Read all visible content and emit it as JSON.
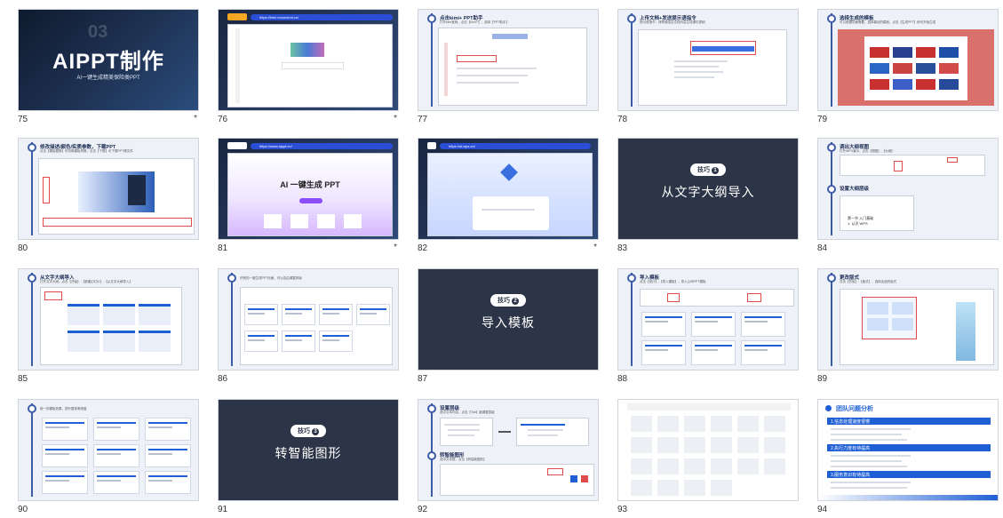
{
  "slides": [
    {
      "num": "75",
      "star": "*",
      "big_title": "AIPPT制作",
      "bg_number": "03",
      "subtitle": "AI一键生成精美保险类PPT"
    },
    {
      "num": "76",
      "star": "*",
      "url": "https://kimi.moonshot.cn/"
    },
    {
      "num": "77",
      "star": "",
      "title": "点击kimi+ PPT助手",
      "sub": "打开kimi官网，点击【Kimi+】，选择【PPT助手】"
    },
    {
      "num": "78",
      "star": "",
      "title": "上传文档+发送提示语指令",
      "sub": "提示语指令：请帮我结合文档内容生成课件提纲"
    },
    {
      "num": "79",
      "star": "",
      "title": "选择生成的模板",
      "sub": "可以根据场景需要，选择喜欢的模板，点击【生成PPT】即可开始生成"
    },
    {
      "num": "80",
      "star": "",
      "title": "修改描述/颜色/实质参数，下载PPT",
      "sub": "点击【模板替换】可切换模板风格，点击【下载】可下载PPT源文件"
    },
    {
      "num": "81",
      "star": "*",
      "url": "https://www.aippt.cn/",
      "hero": "AI 一键生成 PPT"
    },
    {
      "num": "82",
      "star": "*",
      "url": "https://ai.wps.cn/"
    },
    {
      "num": "83",
      "star": "",
      "pill": "技巧",
      "pill_n": "1",
      "main": "从文字大纲导入"
    },
    {
      "num": "84",
      "star": "",
      "title": "调出大纲视图",
      "sub": "打开WPS演示，点击【视图】-【大纲】",
      "title2": "设置大纲层级",
      "line1": "第一节 入门基础",
      "line2": "1. 认识 WPS"
    },
    {
      "num": "85",
      "star": "",
      "title": "从文字大纲导入",
      "sub": "打开文字大纲，点击【开始】-【新建幻灯片】-【从文字大纲导入】"
    },
    {
      "num": "86",
      "star": "",
      "sub": "识别的一键生成PPT页面，可以自由调整排版"
    },
    {
      "num": "87",
      "star": "",
      "pill": "技巧",
      "pill_n": "2",
      "main": "导入模板"
    },
    {
      "num": "88",
      "star": "",
      "title": "导入模板",
      "sub": "点击【设计】-【导入模板】，导入公司PPT模板"
    },
    {
      "num": "89",
      "star": "",
      "title": "更改版式",
      "sub": "点击【开始】-【版式】，选择合适的版式"
    },
    {
      "num": "90",
      "star": "",
      "sub": "统一的模板效果，提升整体美观度"
    },
    {
      "num": "91",
      "star": "",
      "pill": "技巧",
      "pill_n": "3",
      "main": "转智能图形"
    },
    {
      "num": "92",
      "star": "",
      "title": "设置层级",
      "sub": "选中文本内容，点击【Tab】键调整层级",
      "title2": "转智能图形",
      "sub2": "选中文本框，点击【转智能图形】"
    },
    {
      "num": "93",
      "star": "",
      "sub": ""
    },
    {
      "num": "94",
      "star": "",
      "heading": "团队问题分析",
      "sec1": "1.信息处理速度很慢",
      "sec2": "2.执行力度有待提高",
      "sec3": "3.服务意识有待提高"
    }
  ],
  "colors": {
    "accent": "#1f5fd6",
    "dark_slide": "#2c3447",
    "timeline": "#3d5ca8",
    "cover_bg": "#1b2740"
  }
}
